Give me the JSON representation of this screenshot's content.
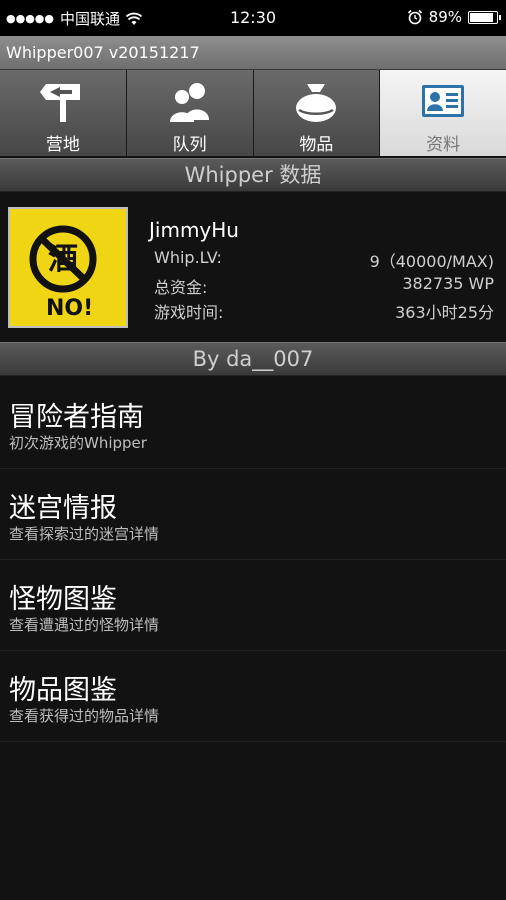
{
  "status_bar": {
    "signal_dots": "●●●●●",
    "carrier": "中国联通",
    "time": "12:30",
    "battery_percent": "89%",
    "battery_level": 0.89
  },
  "app": {
    "title": "Whipper007 v20151217"
  },
  "tabs": [
    {
      "label": "营地",
      "icon": "signpost-icon"
    },
    {
      "label": "队列",
      "icon": "people-icon"
    },
    {
      "label": "物品",
      "icon": "bag-icon"
    },
    {
      "label": "资料",
      "icon": "profile-card-icon",
      "active": true
    }
  ],
  "profile_section": {
    "header": "Whipper 数据",
    "name": "JimmyHu",
    "stats": [
      {
        "label": "Whip.LV:",
        "value": "9（40000/MAX)"
      },
      {
        "label": "总资金:",
        "value": "382735 WP"
      },
      {
        "label": "游戏时间:",
        "value": "363小时25分"
      }
    ]
  },
  "credits_header": "By da__007",
  "menu": [
    {
      "title": "冒险者指南",
      "subtitle": "初次游戏的Whipper"
    },
    {
      "title": "迷宫情报",
      "subtitle": "查看探索过的迷宫详情"
    },
    {
      "title": "怪物图鉴",
      "subtitle": "查看遭遇过的怪物详情"
    },
    {
      "title": "物品图鉴",
      "subtitle": "查看获得过的物品详情"
    }
  ]
}
